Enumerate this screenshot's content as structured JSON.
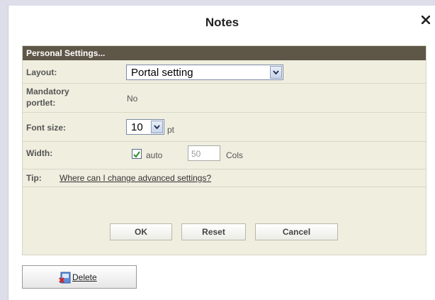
{
  "dialog": {
    "title": "Notes",
    "close_symbol": "✕"
  },
  "panel": {
    "header": "Personal Settings...",
    "layout": {
      "label": "Layout:",
      "value": "Portal setting"
    },
    "mandatory": {
      "label_line1": "Mandatory",
      "label_line2": "portlet:",
      "value": "No"
    },
    "font_size": {
      "label": "Font size:",
      "value": "10",
      "unit": "pt"
    },
    "width": {
      "label": "Width:",
      "auto_checked": true,
      "auto_label": "auto",
      "cols_value": "50",
      "cols_label": "Cols"
    },
    "tip": {
      "label": "Tip:",
      "link": "Where can I change advanced settings?"
    },
    "buttons": {
      "ok": "OK",
      "reset": "Reset",
      "cancel": "Cancel"
    }
  },
  "delete_button": {
    "label": "Delete",
    "icon": "delete-document-icon"
  },
  "colors": {
    "panel_bg": "#efeedf",
    "header_bg": "#5e5647",
    "page_bg": "#dedeea"
  }
}
